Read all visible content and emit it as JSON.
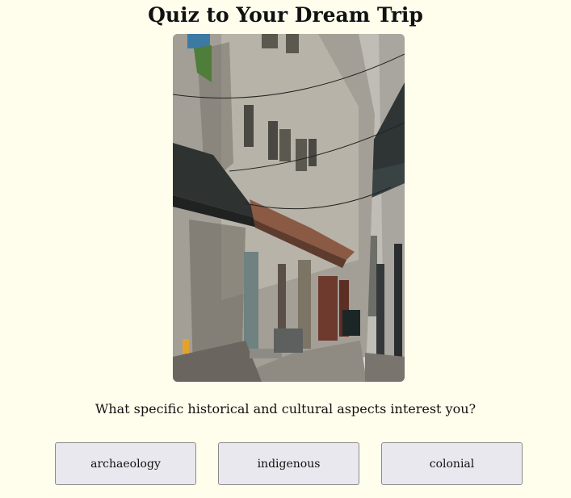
{
  "quiz": {
    "title": "Quiz to Your Dream Trip",
    "question": "What specific historical and cultural aspects interest you?",
    "options": [
      {
        "label": "archaeology"
      },
      {
        "label": "indigenous"
      },
      {
        "label": "colonial"
      }
    ]
  },
  "colors": {
    "page_background": "#fffeed",
    "button_background": "#e8e8ee",
    "button_border": "#8a8a8a"
  }
}
